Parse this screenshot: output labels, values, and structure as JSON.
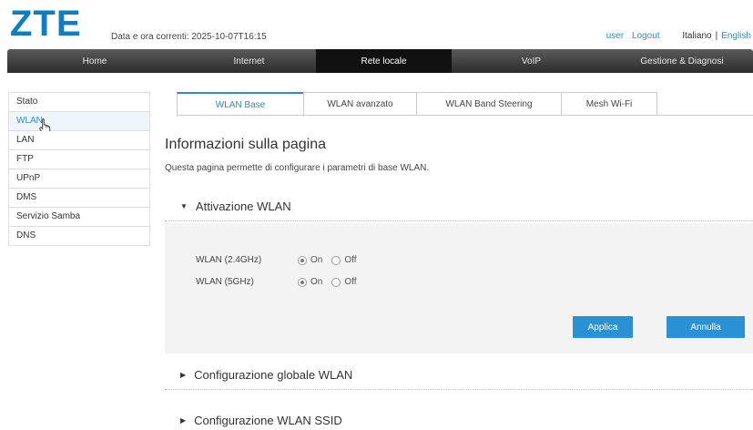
{
  "header": {
    "logo": "ZTE",
    "datetime": "Data e ora correnti: 2025-10-07T16:15",
    "user": "user",
    "logout": "Logout",
    "lang_it": "Italiano",
    "lang_sep": "|",
    "lang_en": "English"
  },
  "nav": {
    "items": [
      "Home",
      "Internet",
      "Rete locale",
      "VoIP",
      "Gestione & Diagnosi"
    ],
    "active": "Rete locale"
  },
  "sidebar": {
    "items": [
      "Stato",
      "WLAN",
      "LAN",
      "FTP",
      "UPnP",
      "DMS",
      "Servizio Samba",
      "DNS"
    ],
    "active": "WLAN"
  },
  "tabs": {
    "items": [
      "WLAN Base",
      "WLAN avanzato",
      "WLAN Band Steering",
      "Mesh Wi-Fi"
    ],
    "active": "WLAN Base"
  },
  "page": {
    "title": "Informazioni sulla pagina",
    "description": "Questa pagina permette di configurare i parametri di base WLAN."
  },
  "sections": {
    "activation": {
      "title": "Attivazione WLAN",
      "expanded": true,
      "rows": [
        {
          "label": "WLAN (2.4GHz)",
          "on": "On",
          "off": "Off",
          "value": "On"
        },
        {
          "label": "WLAN (5GHz)",
          "on": "On",
          "off": "Off",
          "value": "On"
        }
      ],
      "apply": "Applica",
      "cancel": "Annulla"
    },
    "global": {
      "title": "Configurazione globale WLAN",
      "expanded": false
    },
    "ssid": {
      "title": "Configurazione WLAN SSID",
      "expanded": false
    }
  },
  "colors": {
    "accent": "#2a92d4",
    "brand": "#0b7fc2",
    "nav_bg": "#3a3a3a"
  }
}
